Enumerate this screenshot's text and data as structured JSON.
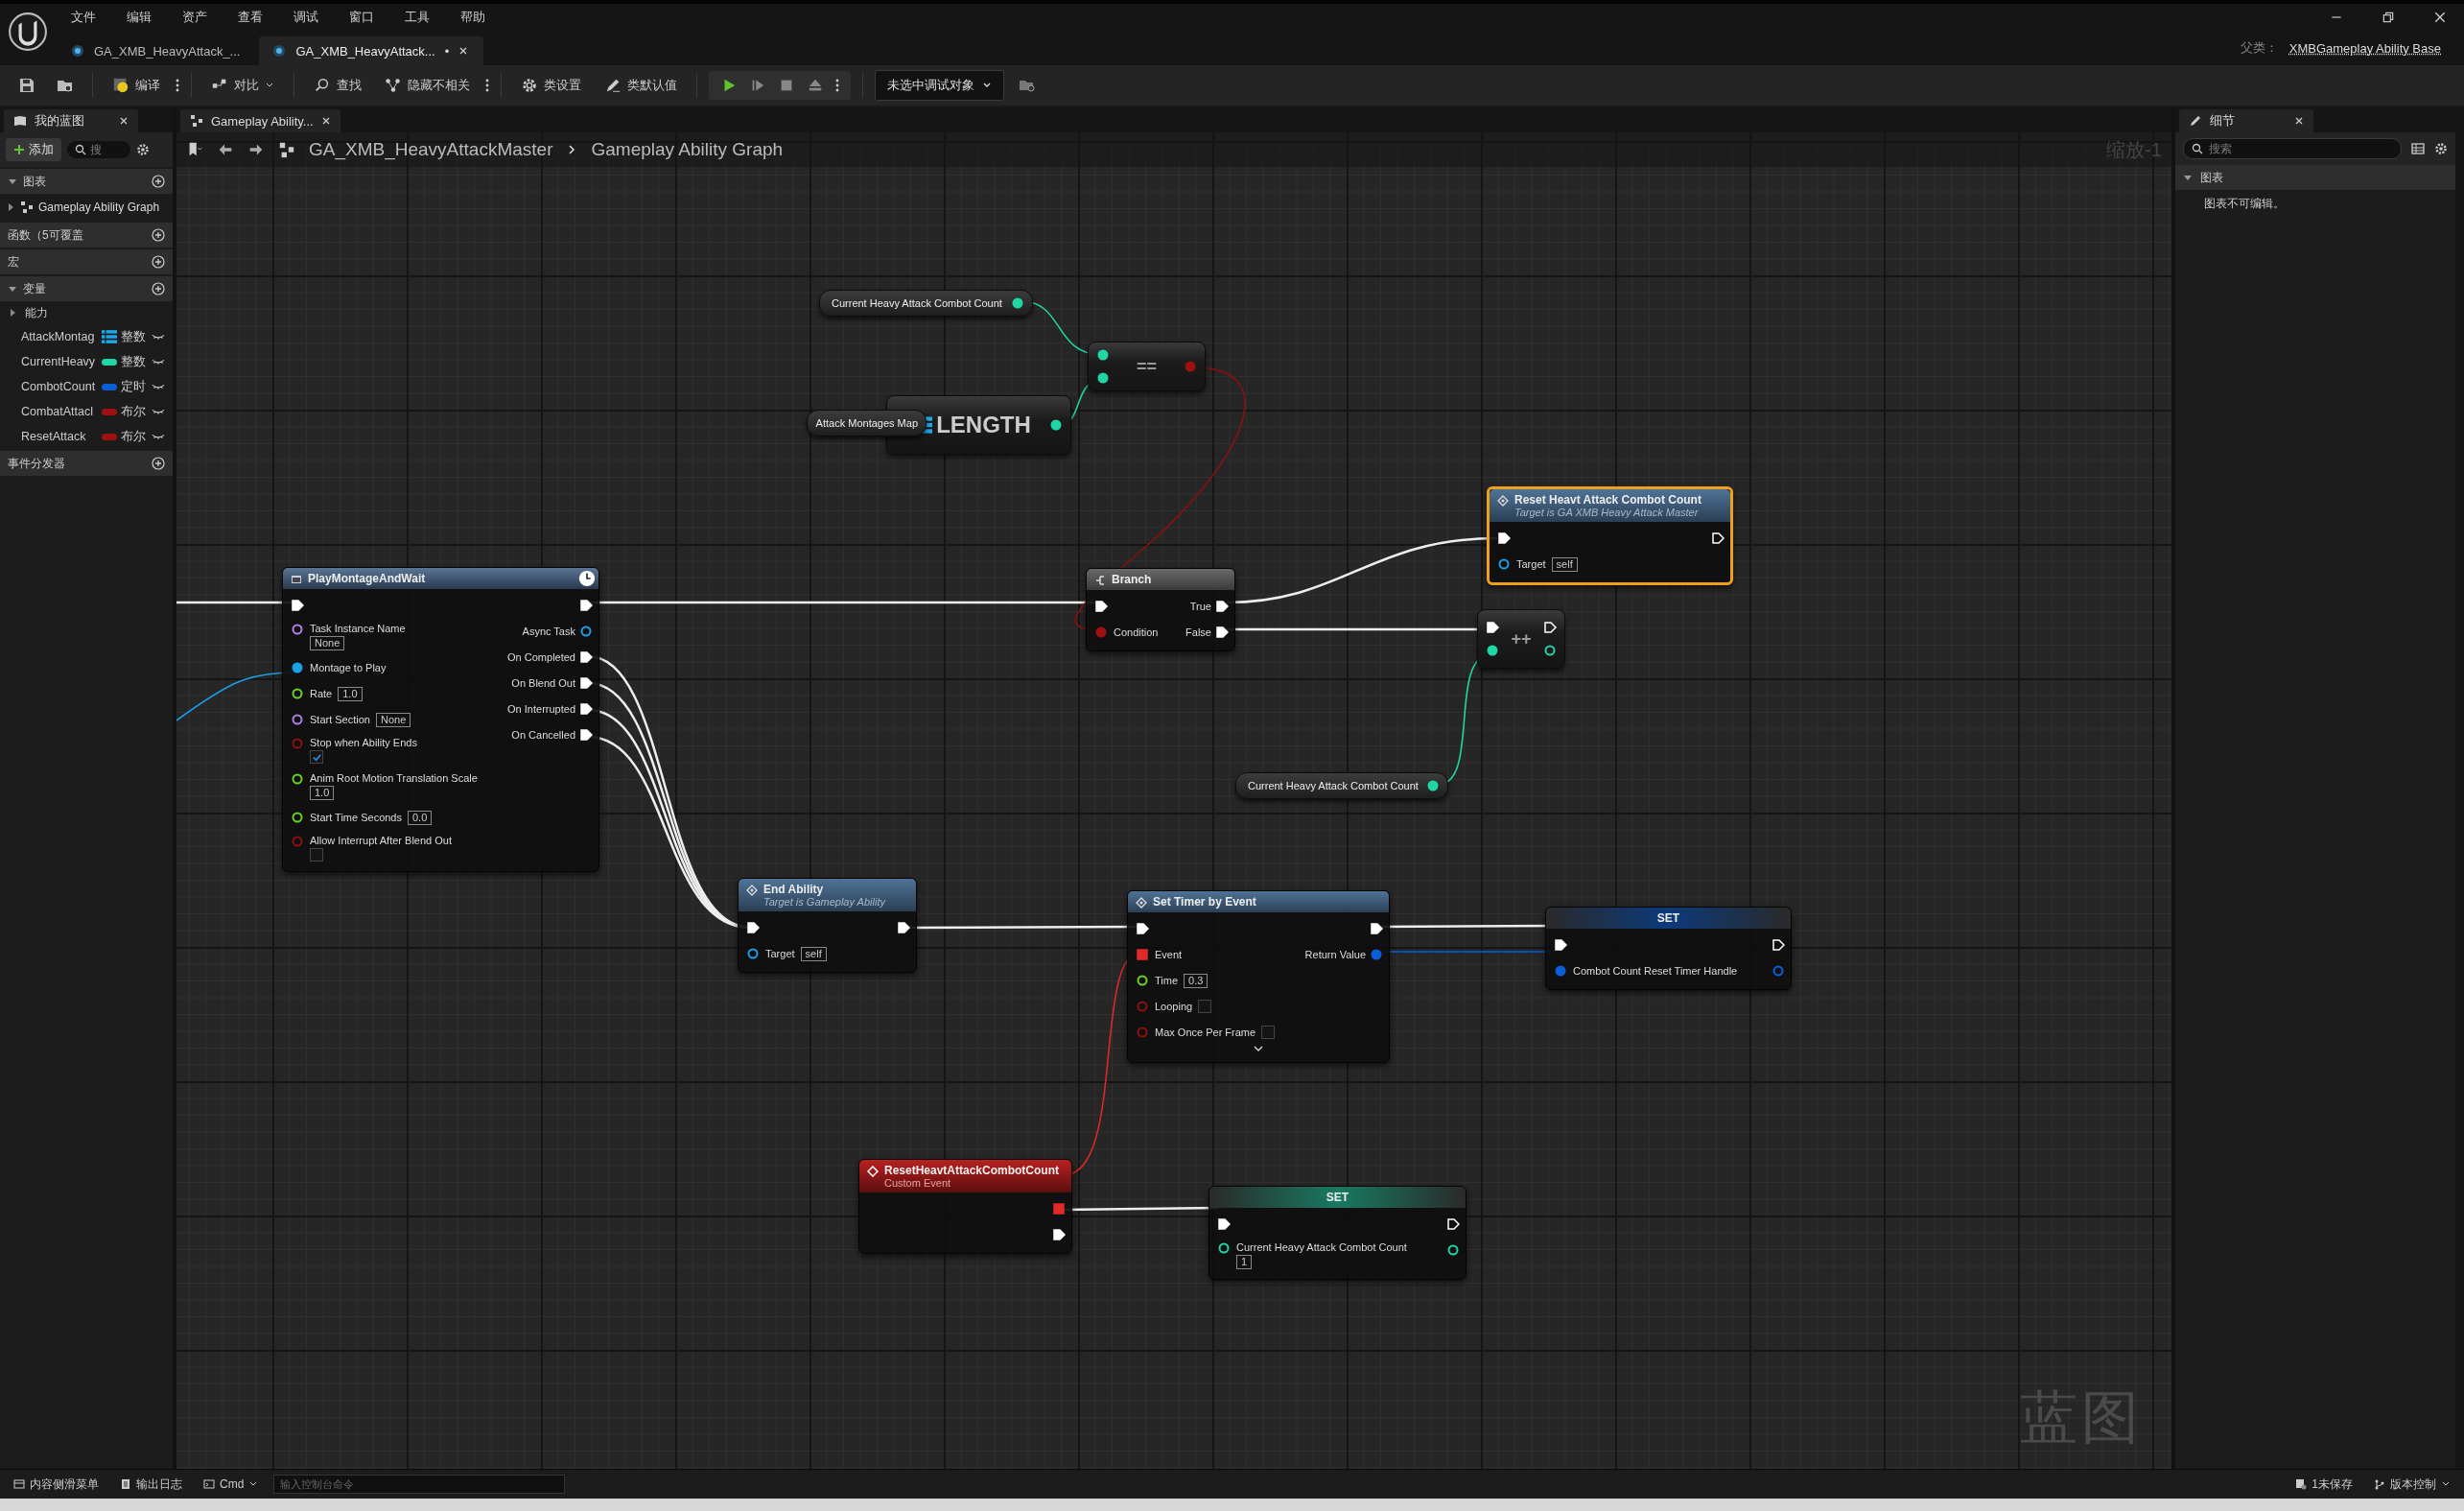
{
  "menu": [
    "文件",
    "编辑",
    "资产",
    "查看",
    "调试",
    "窗口",
    "工具",
    "帮助"
  ],
  "document_tabs": [
    {
      "label": "GA_XMB_HeavyAttack_...",
      "selected": false
    },
    {
      "label": "GA_XMB_HeavyAttack...",
      "selected": true,
      "dirty_mark": "•"
    }
  ],
  "parent_class": {
    "label": "父类：",
    "value": "XMBGameplay Ability Base"
  },
  "toolbar": {
    "compile": "编译",
    "diff": "对比",
    "find": "查找",
    "hide_unrelated": "隐藏不相关",
    "class_settings": "类设置",
    "class_defaults": "类默认值",
    "debug_target": "未选中调试对象"
  },
  "my_blueprint": {
    "title": "我的蓝图",
    "add_label": "添加",
    "search_placeholder": "搜",
    "sections": [
      {
        "label": "图表",
        "expanded": true,
        "items": [
          "Gameplay Ability Graph"
        ]
      },
      {
        "label": "函数（5可覆盖",
        "expanded": false
      },
      {
        "label": "宏",
        "expanded": false
      },
      {
        "label": "变量",
        "expanded": true,
        "category": "能力",
        "variables": [
          {
            "name": "AttackMontag",
            "type": "整数",
            "color": "#1fa8e8",
            "kind": "array"
          },
          {
            "name": "CurrentHeavy",
            "type": "整数",
            "color": "#1fd6a6",
            "kind": "single"
          },
          {
            "name": "CombotCount",
            "type": "定时",
            "color": "#0a5ed8",
            "kind": "single"
          },
          {
            "name": "CombatAttacl",
            "type": "布尔",
            "color": "#a01010",
            "kind": "single"
          },
          {
            "name": "ResetAttack",
            "type": "布尔",
            "color": "#a01010",
            "kind": "single"
          }
        ]
      },
      {
        "label": "事件分发器",
        "expanded": false
      }
    ]
  },
  "graph": {
    "tab": "Gameplay Ability...",
    "breadcrumb": [
      "GA_XMB_HeavyAttackMaster",
      "Gameplay Ability Graph"
    ],
    "zoom": "缩放-1",
    "watermark": "蓝图",
    "nodes": [
      {
        "kind": "getter",
        "title": "Current Heavy Attack Combot Count",
        "selected": false,
        "outputs": [
          {
            "kind": "data",
            "color": "#1fd6a6",
            "linked": true
          }
        ]
      },
      {
        "kind": "compact",
        "title": "==",
        "selected": false,
        "inputs": [
          {
            "kind": "data",
            "color": "#1fd6a6",
            "linked": true
          },
          {
            "kind": "data",
            "color": "#1fd6a6",
            "linked": true
          }
        ],
        "outputs": [
          {
            "kind": "data",
            "color": "#a01010",
            "linked": true
          }
        ]
      },
      {
        "kind": "array_op",
        "title": "LENGTH",
        "selected": false,
        "outputs": [
          {
            "kind": "data",
            "color": "#1fd6a6",
            "linked": true
          }
        ]
      },
      {
        "kind": "getter",
        "title": "Attack Montages Map",
        "selected": false
      },
      {
        "kind": "function",
        "title": "Reset Heavt Attack Combot Count",
        "subtitle": "Target is GA XMB Heavy Attack Master",
        "selected": true,
        "inputs": [
          {
            "kind": "exec",
            "linked": true
          },
          {
            "kind": "data",
            "label": "Target",
            "color": "#1b9fe6",
            "linked": false,
            "value": "self"
          }
        ],
        "outputs": [
          {
            "kind": "exec",
            "linked": false
          }
        ]
      },
      {
        "kind": "branch",
        "title": "Branch",
        "selected": false,
        "inputs": [
          {
            "kind": "exec",
            "linked": true
          },
          {
            "kind": "data",
            "label": "Condition",
            "color": "#a01010",
            "linked": true
          }
        ],
        "outputs": [
          {
            "kind": "exec",
            "label": "True",
            "linked": true
          },
          {
            "kind": "exec",
            "label": "False",
            "linked": true
          }
        ]
      },
      {
        "kind": "compact",
        "title": "++",
        "selected": false,
        "inputs": [
          {
            "kind": "exec",
            "linked": true
          },
          {
            "kind": "data",
            "color": "#1fd6a6",
            "linked": true
          }
        ],
        "outputs": [
          {
            "kind": "exec",
            "linked": false
          },
          {
            "kind": "data",
            "color": "#1fd6a6",
            "linked": false
          }
        ]
      },
      {
        "kind": "getter",
        "title": "Current Heavy Attack Combot Count",
        "selected": false,
        "outputs": [
          {
            "kind": "data",
            "color": "#1fd6a6",
            "linked": true
          }
        ]
      },
      {
        "kind": "async",
        "title": "PlayMontageAndWait",
        "selected": false,
        "inputs": [
          {
            "kind": "exec",
            "linked": true
          },
          {
            "kind": "data",
            "label": "Task Instance Name",
            "color": "#b07ee6",
            "linked": false,
            "value": "None"
          },
          {
            "kind": "data",
            "label": "Montage to Play",
            "color": "#1b9fe6",
            "linked": true
          },
          {
            "kind": "data",
            "label": "Rate",
            "color": "#6ad02c",
            "linked": false,
            "value": "1.0"
          },
          {
            "kind": "data",
            "label": "Start Section",
            "color": "#b07ee6",
            "linked": false,
            "value": "None"
          },
          {
            "kind": "data",
            "label": "Stop when Ability Ends",
            "color": "#8c1010",
            "linked": false,
            "checked": true
          },
          {
            "kind": "data",
            "label": "Anim Root Motion Translation Scale",
            "color": "#6ad02c",
            "linked": false,
            "value": "1.0"
          },
          {
            "kind": "data",
            "label": "Start Time Seconds",
            "color": "#6ad02c",
            "linked": false,
            "value": "0.0"
          },
          {
            "kind": "data",
            "label": "Allow Interrupt After Blend Out",
            "color": "#8c1010",
            "linked": false,
            "checked": false
          }
        ],
        "outputs": [
          {
            "kind": "exec",
            "linked": true
          },
          {
            "kind": "data",
            "label": "Async Task",
            "color": "#1b9fe6",
            "linked": false
          },
          {
            "kind": "exec",
            "label": "On Completed",
            "linked": true
          },
          {
            "kind": "exec",
            "label": "On Blend Out",
            "linked": true
          },
          {
            "kind": "exec",
            "label": "On Interrupted",
            "linked": true
          },
          {
            "kind": "exec",
            "label": "On Cancelled",
            "linked": true
          }
        ]
      },
      {
        "kind": "function",
        "title": "End Ability",
        "subtitle": "Target is Gameplay Ability",
        "selected": false,
        "inputs": [
          {
            "kind": "exec",
            "linked": true
          },
          {
            "kind": "data",
            "label": "Target",
            "color": "#1b9fe6",
            "linked": false,
            "value": "self"
          }
        ],
        "outputs": [
          {
            "kind": "exec",
            "linked": true
          }
        ]
      },
      {
        "kind": "function",
        "title": "Set Timer by Event",
        "selected": false,
        "expandable": true,
        "inputs": [
          {
            "kind": "exec",
            "linked": true
          },
          {
            "kind": "delegate",
            "label": "Event",
            "color": "#e02a2a",
            "linked": true
          },
          {
            "kind": "data",
            "label": "Time",
            "color": "#6ad02c",
            "linked": false,
            "value": "0.3"
          },
          {
            "kind": "data",
            "label": "Looping",
            "color": "#8c1010",
            "linked": false,
            "checked": false
          },
          {
            "kind": "data",
            "label": "Max Once Per Frame",
            "color": "#8c1010",
            "linked": false,
            "checked": false
          }
        ],
        "outputs": [
          {
            "kind": "exec",
            "linked": true
          },
          {
            "kind": "data",
            "label": "Return Value",
            "color": "#0a5ed8",
            "linked": true
          }
        ]
      },
      {
        "kind": "set",
        "title": "SET",
        "selected": false,
        "inputs": [
          {
            "kind": "exec",
            "linked": true
          },
          {
            "kind": "data",
            "label": "Combot Count Reset Timer Handle",
            "color": "#0a5ed8",
            "linked": true
          }
        ],
        "outputs": [
          {
            "kind": "exec",
            "linked": false
          },
          {
            "kind": "data",
            "color": "#0a5ed8",
            "linked": false
          }
        ]
      },
      {
        "kind": "event",
        "title": "ResetHeavtAttackCombotCount",
        "subtitle": "Custom Event",
        "selected": false,
        "outputs": [
          {
            "kind": "delegate",
            "color": "#e02a2a",
            "linked": true
          },
          {
            "kind": "exec",
            "linked": true
          }
        ]
      },
      {
        "kind": "set",
        "title": "SET",
        "selected": false,
        "inputs": [
          {
            "kind": "exec",
            "linked": true
          },
          {
            "kind": "data",
            "label": "Current Heavy Attack Combot Count",
            "color": "#1fd6a6",
            "linked": false,
            "value": "1"
          }
        ],
        "outputs": [
          {
            "kind": "exec",
            "linked": false
          },
          {
            "kind": "data",
            "color": "#1fd6a6",
            "linked": false
          }
        ]
      }
    ]
  },
  "details": {
    "title": "细节",
    "search_placeholder": "搜索",
    "section": "图表",
    "message": "图表不可编辑。"
  },
  "status_bar": {
    "content_drawer": "内容侧滑菜单",
    "output_log": "输出日志",
    "cmd": "Cmd",
    "console_placeholder": "输入控制台命令",
    "unsaved": "1未保存",
    "source_control": "版本控制"
  }
}
